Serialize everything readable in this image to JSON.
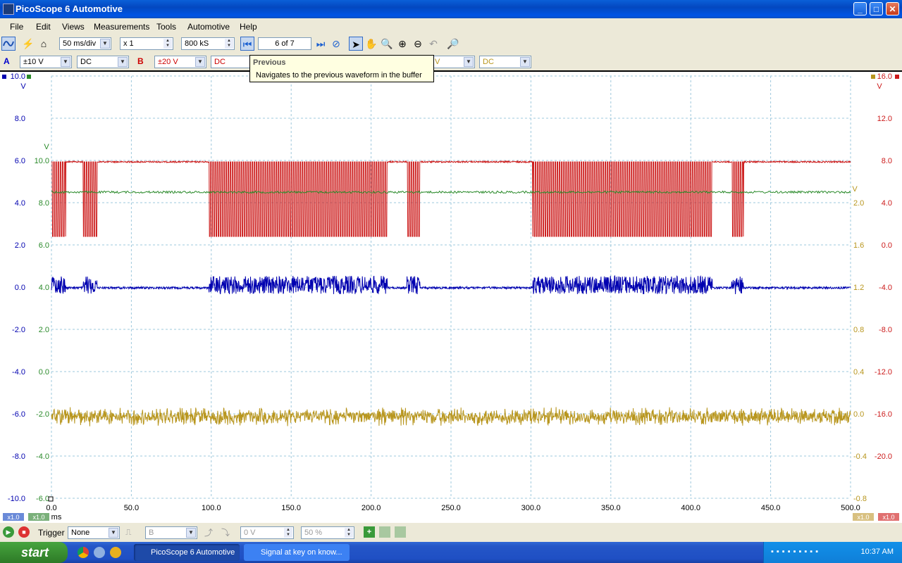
{
  "window": {
    "title": "PicoScope 6 Automotive",
    "min": "_",
    "max": "□",
    "close": "✕"
  },
  "menu": [
    "File",
    "Edit",
    "Views",
    "Measurements",
    "Tools",
    "Automotive",
    "Help"
  ],
  "toolbar": {
    "timebase": "50 ms/div",
    "zoom": "x 1",
    "samples": "800 kS",
    "buffer": "6  of 7"
  },
  "channels": {
    "a": {
      "label": "A",
      "range": "±10 V",
      "coupling": "DC",
      "color": "#0000cc"
    },
    "b": {
      "label": "B",
      "range": "±20 V",
      "coupling": "DC",
      "color": "#cc0000"
    },
    "d": {
      "range_frag": "V",
      "coupling": "DC"
    }
  },
  "tooltip": {
    "title": "Previous",
    "body": "Navigates to the previous waveform in the buffer"
  },
  "axes": {
    "a_ticks": [
      "10.0",
      "8.0",
      "6.0",
      "4.0",
      "2.0",
      "0.0",
      "-2.0",
      "-4.0",
      "-6.0",
      "-8.0",
      "-10.0"
    ],
    "a_unit": "V",
    "c_ticks": [
      "10.0",
      "8.0",
      "6.0",
      "4.0",
      "2.0",
      "0.0",
      "-2.0",
      "-4.0",
      "-6.0"
    ],
    "c_unit": "V",
    "d_ticks": [
      "2.0",
      "1.6",
      "1.2",
      "0.8",
      "0.4",
      "0.0",
      "-0.4",
      "-0.8"
    ],
    "d_unit": "V",
    "b_ticks": [
      "16.0",
      "12.0",
      "8.0",
      "4.0",
      "0.0",
      "-4.0",
      "-8.0",
      "-12.0",
      "-16.0",
      "-20.0"
    ],
    "b_unit": "V",
    "x_ticks": [
      "0.0",
      "50.0",
      "100.0",
      "150.0",
      "200.0",
      "250.0",
      "300.0",
      "350.0",
      "400.0",
      "450.0",
      "500.0"
    ],
    "x_unit": "ms",
    "scale_labels": [
      "x1.0",
      "x1.0",
      "x1.0",
      "x1.0"
    ]
  },
  "colors": {
    "a": "#0000b0",
    "b": "#cc1a1a",
    "c": "#2a8a2a",
    "d": "#b8961e",
    "grid": "#9ec8dc"
  },
  "bottom": {
    "trigger_label": "Trigger",
    "trigger_mode": "None",
    "source": "B",
    "level": "0 V",
    "percent": "50 %"
  },
  "taskbar": {
    "start": "start",
    "tasks": [
      "PicoScope 6 Automotive",
      "Signal at key on know..."
    ],
    "clock": "10:37 AM"
  }
}
